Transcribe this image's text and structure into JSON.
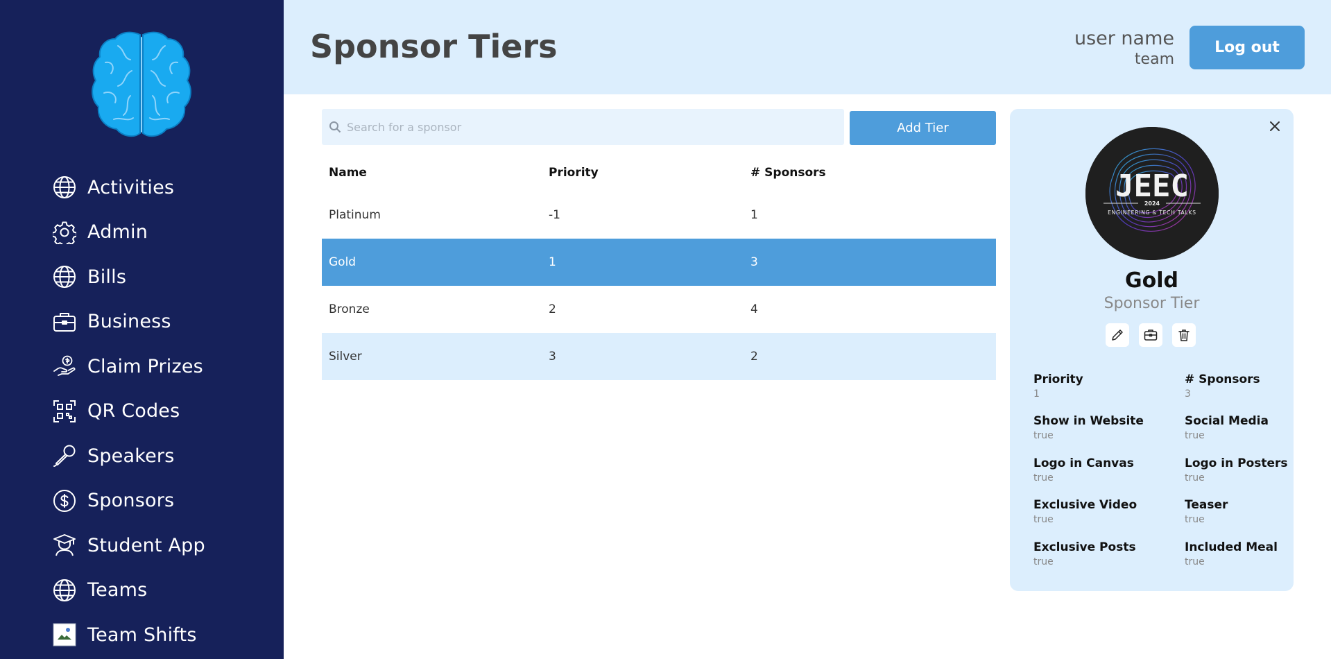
{
  "sidebar": {
    "logo_icon": "brain-icon",
    "items": [
      {
        "label": "Activities",
        "icon": "globe-icon"
      },
      {
        "label": "Admin",
        "icon": "gear-icon"
      },
      {
        "label": "Bills",
        "icon": "globe-icon"
      },
      {
        "label": "Business",
        "icon": "briefcase-icon"
      },
      {
        "label": "Claim Prizes",
        "icon": "hand-coin-icon"
      },
      {
        "label": "QR Codes",
        "icon": "qr-code-icon"
      },
      {
        "label": "Speakers",
        "icon": "microphone-icon"
      },
      {
        "label": "Sponsors",
        "icon": "dollar-circle-icon"
      },
      {
        "label": "Student App",
        "icon": "student-icon"
      },
      {
        "label": "Teams",
        "icon": "globe-icon"
      },
      {
        "label": "Team Shifts",
        "icon": "broken-image-icon"
      }
    ]
  },
  "header": {
    "title": "Sponsor Tiers",
    "user_name": "user name",
    "user_team": "team",
    "logout_label": "Log out"
  },
  "search": {
    "placeholder": "Search for a sponsor"
  },
  "toolbar": {
    "add_label": "Add Tier"
  },
  "table": {
    "columns": [
      "Name",
      "Priority",
      "# Sponsors"
    ],
    "rows": [
      {
        "name": "Platinum",
        "priority": "-1",
        "sponsors": "1"
      },
      {
        "name": "Gold",
        "priority": "1",
        "sponsors": "3"
      },
      {
        "name": "Bronze",
        "priority": "2",
        "sponsors": "4"
      },
      {
        "name": "Silver",
        "priority": "3",
        "sponsors": "2"
      }
    ],
    "selected_row": 1
  },
  "detail": {
    "logo_title": "JEEC",
    "logo_year": "2024",
    "logo_tagline": "ENGINEERING & TECH TALKS",
    "name": "Gold",
    "subtitle": "Sponsor Tier",
    "fields": [
      {
        "label": "Priority",
        "value": "1"
      },
      {
        "label": "# Sponsors",
        "value": "3"
      },
      {
        "label": "Show in Website",
        "value": "true"
      },
      {
        "label": "Social Media",
        "value": "true"
      },
      {
        "label": "Logo in Canvas",
        "value": "true"
      },
      {
        "label": "Logo in Posters",
        "value": "true"
      },
      {
        "label": "Exclusive Video",
        "value": "true"
      },
      {
        "label": "Teaser",
        "value": "true"
      },
      {
        "label": "Exclusive Posts",
        "value": "true"
      },
      {
        "label": "Included Meal",
        "value": "true"
      }
    ]
  },
  "colors": {
    "sidebar_bg": "#16215a",
    "accent": "#4e9ddb",
    "light_bg": "#dceefd"
  }
}
